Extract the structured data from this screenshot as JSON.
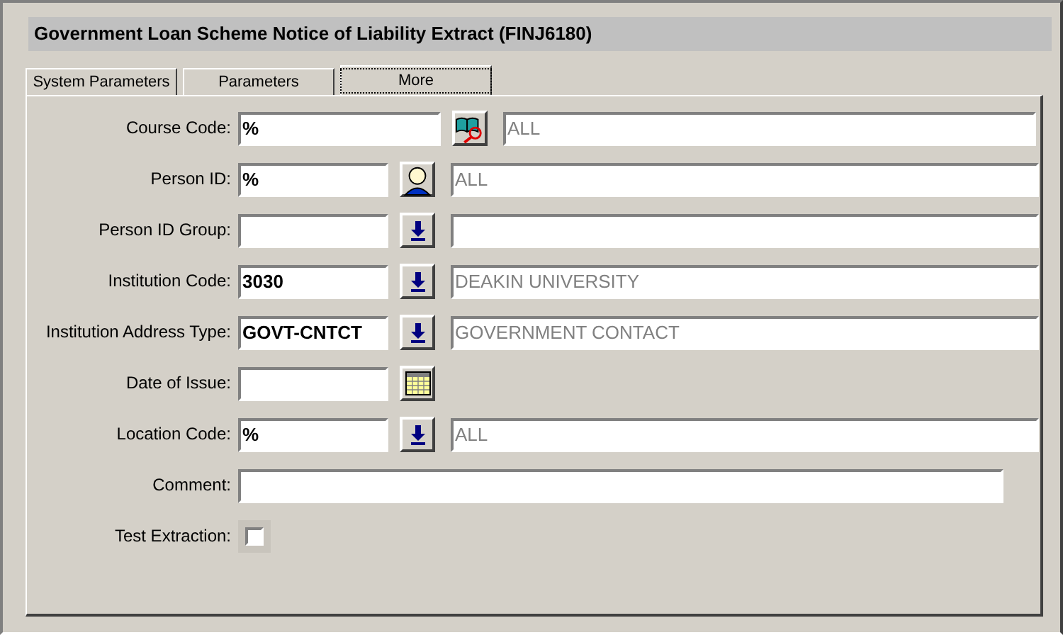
{
  "window": {
    "title": "Government Loan Scheme Notice of Liability Extract (FINJ6180)"
  },
  "tabs": [
    {
      "label": "System Parameters",
      "selected": false
    },
    {
      "label": "Parameters",
      "selected": false
    },
    {
      "label": "More",
      "selected": true
    }
  ],
  "fields": [
    {
      "kind": "wide-lookup",
      "label": "Course Code:",
      "value": "%",
      "button": {
        "kind": "book"
      },
      "description": "ALL"
    },
    {
      "kind": "lookup",
      "label": "Person ID:",
      "value": "%",
      "button": {
        "kind": "person"
      },
      "description": "ALL"
    },
    {
      "kind": "lookup",
      "label": "Person ID Group:",
      "button": {
        "kind": "arrow"
      }
    },
    {
      "kind": "lookup",
      "label": "Institution Code:",
      "value": "3030",
      "button": {
        "kind": "arrow"
      },
      "description": "DEAKIN UNIVERSITY"
    },
    {
      "kind": "lookup",
      "label": "Institution Address Type:",
      "value": "GOVT-CNTCT",
      "button": {
        "kind": "arrow"
      },
      "description": "GOVERNMENT CONTACT"
    },
    {
      "kind": "date",
      "label": "Date of Issue:",
      "button": {
        "kind": "calendar"
      }
    },
    {
      "kind": "lookup",
      "label": "Location Code:",
      "value": "%",
      "button": {
        "kind": "arrow"
      },
      "description": "ALL"
    },
    {
      "kind": "text",
      "label": "Comment:"
    },
    {
      "kind": "checkbox",
      "label": "Test Extraction:",
      "checked": false
    }
  ]
}
